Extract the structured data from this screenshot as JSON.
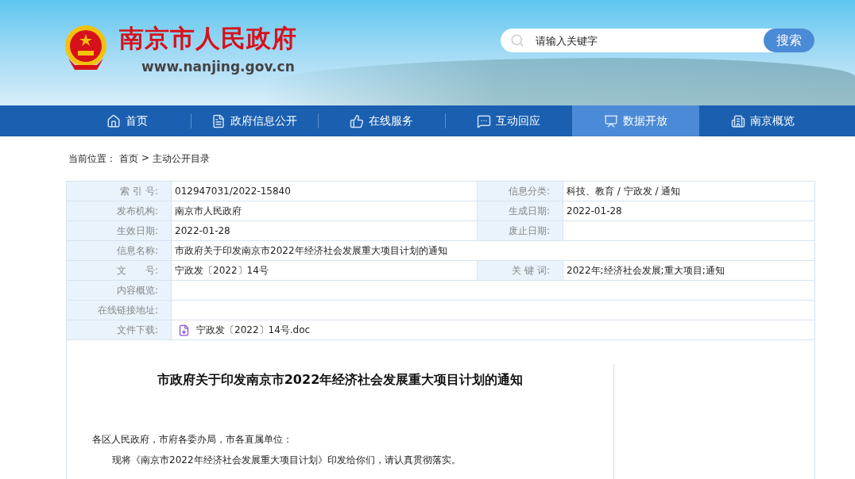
{
  "header": {
    "site_name": "南京市人民政府",
    "site_url": "www.**nanjing**.gov.cn",
    "search": {
      "placeholder": "请输入关键字",
      "button": "搜索"
    }
  },
  "nav": [
    {
      "label": "首页",
      "selected": false
    },
    {
      "label": "政府信息公开",
      "selected": false
    },
    {
      "label": "在线服务",
      "selected": false
    },
    {
      "label": "互动回应",
      "selected": false
    },
    {
      "label": "数据开放",
      "selected": true
    },
    {
      "label": "南京概览",
      "selected": false
    }
  ],
  "breadcrumb": {
    "prefix": "当前位置：",
    "items": [
      "首页",
      "主动公开目录"
    ],
    "separator": ">"
  },
  "info_table": [
    {
      "kind": "pair",
      "label": "索 引 号:",
      "value": "012947031/2022-15840",
      "label2": "信息分类:",
      "value2": "科技、教育 / 宁政发 / 通知"
    },
    {
      "kind": "pair",
      "label": "发布机构:",
      "value": "南京市人民政府",
      "label2": "生成日期:",
      "value2": "2022-01-28"
    },
    {
      "kind": "pair",
      "label": "生效日期:",
      "value": "2022-01-28",
      "label2": "废止日期:"
    },
    {
      "kind": "wide",
      "label": "信息名称:",
      "value": "市政府关于印发南京市2022年经济社会发展重大项目计划的通知"
    },
    {
      "kind": "pair",
      "label": "文　　号:",
      "value": "宁政发〔2022〕14号",
      "label2": "关 键 词:",
      "value2": "2022年;经济社会发展;重大项目;通知"
    },
    {
      "kind": "wide",
      "label": "内容概览:"
    },
    {
      "kind": "wide",
      "label": "在线链接地址:"
    },
    {
      "kind": "file",
      "label": "文件下载:",
      "value": "宁政发〔2022〕14号.doc"
    }
  ],
  "article": {
    "title": "市政府关于印发南京市2022年经济社会发展重大项目计划的通知",
    "salutation": "各区人民政府，市府各委办局，市各直属单位：",
    "body": "现将《南京市2022年经济社会发展重大项目计划》印发给你们，请认真贯彻落实。"
  }
}
